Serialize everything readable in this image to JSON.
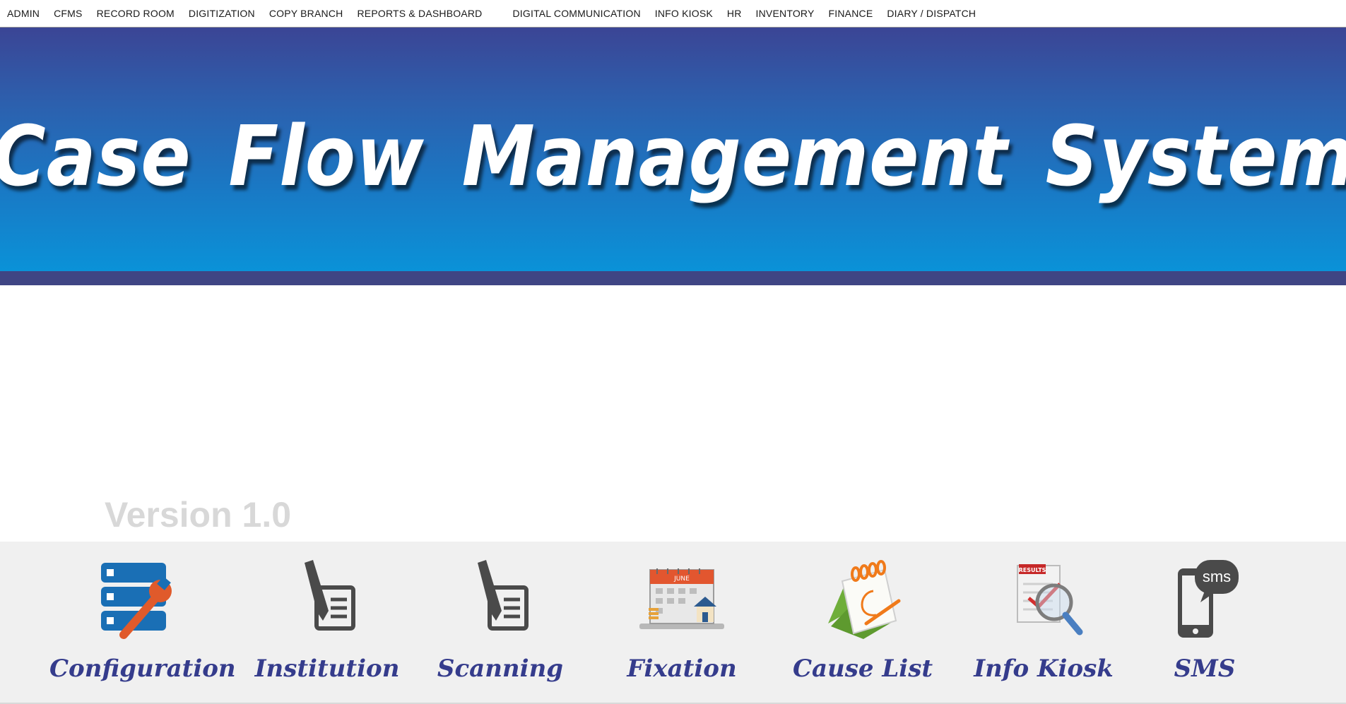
{
  "menu": {
    "items": [
      "ADMIN",
      "CFMS",
      "RECORD ROOM",
      "DIGITIZATION",
      "COPY BRANCH",
      "REPORTS & DASHBOARD",
      "DIGITAL COMMUNICATION",
      "INFO KIOSK",
      "HR",
      "INVENTORY",
      "FINANCE",
      "DIARY / DISPATCH"
    ]
  },
  "banner": {
    "title": "Case Flow Management System"
  },
  "version": "Version 1.0",
  "launcher": {
    "tiles": [
      {
        "label": "Configuration",
        "icon": "server-wrench-icon"
      },
      {
        "label": "Institution",
        "icon": "pen-document-icon"
      },
      {
        "label": "Scanning",
        "icon": "pen-document-icon"
      },
      {
        "label": "Fixation",
        "icon": "calendar-house-icon"
      },
      {
        "label": "Cause List",
        "icon": "notepad-icon"
      },
      {
        "label": "Info Kiosk",
        "icon": "magnifier-results-icon"
      },
      {
        "label": "SMS",
        "icon": "sms-phone-icon"
      }
    ],
    "calendar_month": "JUNE",
    "results_badge": "RESULTS",
    "sms_text": "sms"
  },
  "colors": {
    "banner_top": "#3b4595",
    "banner_bottom": "#0a92d8",
    "strip": "#3f4584",
    "label": "#353c8c",
    "config_blue": "#1a6fb5",
    "wrench": "#e05a2b",
    "icon_gray": "#4a4a4a"
  }
}
